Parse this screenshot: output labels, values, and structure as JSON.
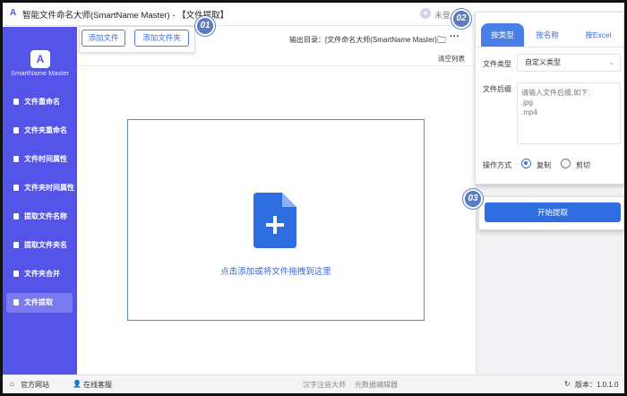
{
  "window": {
    "title": "智能文件命名大师(SmartName Master) - 【文件提取】",
    "login_text": "未登"
  },
  "sidebar": {
    "app_name": "SmartName Master",
    "items": [
      {
        "label": "文件重命名"
      },
      {
        "label": "文件夹重命名"
      },
      {
        "label": "文件时间属性"
      },
      {
        "label": "文件夹时间属性"
      },
      {
        "label": "提取文件名称"
      },
      {
        "label": "提取文件夹名"
      },
      {
        "label": "文件夹合并"
      },
      {
        "label": "文件提取",
        "active": true
      }
    ]
  },
  "toolbar": {
    "add_file_label": "添加文件",
    "add_folder_label": "添加文件夹",
    "output_dir": "输出目录：[文件命名大师(SmartName Master)",
    "clear_list_label": "清空列表"
  },
  "dropzone": {
    "hint": "点击添加或将文件拖拽到这里"
  },
  "settings": {
    "tabs": [
      {
        "label": "按类型",
        "active": true
      },
      {
        "label": "按名称"
      },
      {
        "label": "按Excel"
      }
    ],
    "file_type_label": "文件类型",
    "file_type_value": "自定义类型",
    "suffix_label": "文件后缀",
    "suffix_placeholder": "请输入文件后缀,如下:\n.jpg\n.mp4",
    "operation_label": "操作方式",
    "options": [
      {
        "label": "复制",
        "selected": true
      },
      {
        "label": "剪切",
        "selected": false
      }
    ],
    "start_label": "开始提取"
  },
  "steps": [
    "01",
    "02",
    "03"
  ],
  "bottom_bar": {
    "website_label": "官方网站",
    "service_label": "在线客服",
    "link1": "汉字注音大师",
    "link2": "元数据编辑器",
    "version": "版本：1.0.1.0"
  },
  "colors": {
    "sidebar": "#5454e8",
    "accent": "#2f6ee0",
    "step_marker": "#5a7cc0"
  }
}
